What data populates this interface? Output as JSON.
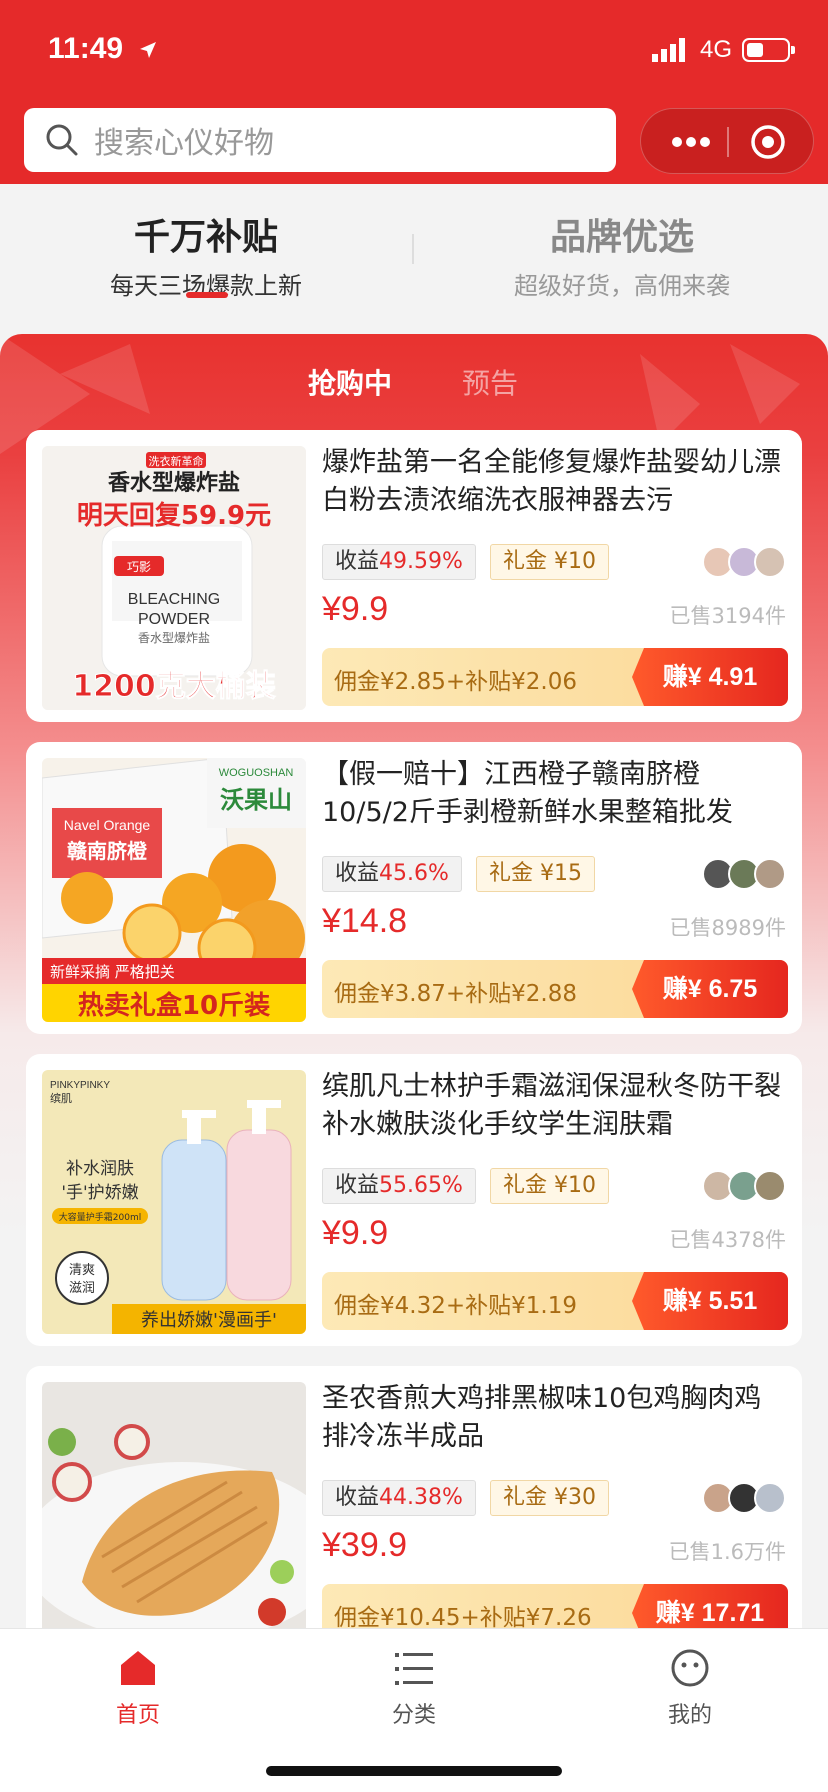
{
  "status": {
    "time": "11:49",
    "network": "4G"
  },
  "search": {
    "placeholder": "搜索心仪好物"
  },
  "tabs": [
    {
      "title": "千万补贴",
      "subtitle": "每天三场爆款上新"
    },
    {
      "title": "品牌优选",
      "subtitle": "超级好货，高佣来袭"
    }
  ],
  "subtabs": {
    "active": "抢购中",
    "inactive": "预告"
  },
  "products": [
    {
      "title": "爆炸盐第一名全能修复爆炸盐婴幼儿漂白粉去渍浓缩洗衣服神器去污",
      "gain_label": "收益",
      "gain_pct": "49.59%",
      "gift": "礼金 ¥10",
      "price": "¥9.9",
      "sold": "已售3194件",
      "commission": "佣金¥2.85+补贴¥2.06",
      "earn": "赚¥ 4.91",
      "thumb": {
        "badge": "洗衣新革命",
        "line1": "香水型爆炸盐",
        "line2": "明天回复59.9元",
        "line3": "1200克大桶装",
        "pkg1": "BLEACHING",
        "pkg2": "POWDER",
        "pkg3": "香水型爆炸盐",
        "brand": "巧影"
      }
    },
    {
      "title": "【假一赔十】江西橙子赣南脐橙10/5/2斤手剥橙新鲜水果整箱批发",
      "gain_label": "收益",
      "gain_pct": "45.6%",
      "gift": "礼金 ¥15",
      "price": "¥14.8",
      "sold": "已售8989件",
      "commission": "佣金¥3.87+补贴¥2.88",
      "earn": "赚¥ 6.75",
      "thumb": {
        "box1": "Navel Orange",
        "box2": "赣南脐橙",
        "brand1": "WOGUOSHAN",
        "brand2": "沃果山",
        "strip1": "新鲜采摘 严格把关",
        "strip2": "热卖礼盒10斤装"
      }
    },
    {
      "title": "缤肌凡士林护手霜滋润保湿秋冬防干裂补水嫩肤淡化手纹学生润肤霜",
      "gain_label": "收益",
      "gain_pct": "55.65%",
      "gift": "礼金 ¥10",
      "price": "¥9.9",
      "sold": "已售4378件",
      "commission": "佣金¥4.32+补贴¥1.19",
      "earn": "赚¥ 5.51",
      "thumb": {
        "brand1": "PINKYPINKY",
        "brand2": "缤肌",
        "line1": "补水润肤",
        "line2": "'手'护娇嫩",
        "line3": "大容量护手霜200ml",
        "seal1": "清爽",
        "seal2": "滋润",
        "bottom": "养出娇嫩'漫画手'"
      }
    },
    {
      "title": "圣农香煎大鸡排黑椒味10包鸡胸肉鸡排冷冻半成品",
      "gain_label": "收益",
      "gain_pct": "44.38%",
      "gift": "礼金 ¥30",
      "price": "¥39.9",
      "sold": "已售1.6万件",
      "commission": "佣金¥10.45+补贴¥7.26",
      "earn": "赚¥ 17.71"
    }
  ],
  "nav": [
    {
      "label": "首页"
    },
    {
      "label": "分类"
    },
    {
      "label": "我的"
    }
  ],
  "colors": {
    "brand": "#e52a2a",
    "gift": "#a86b13"
  }
}
